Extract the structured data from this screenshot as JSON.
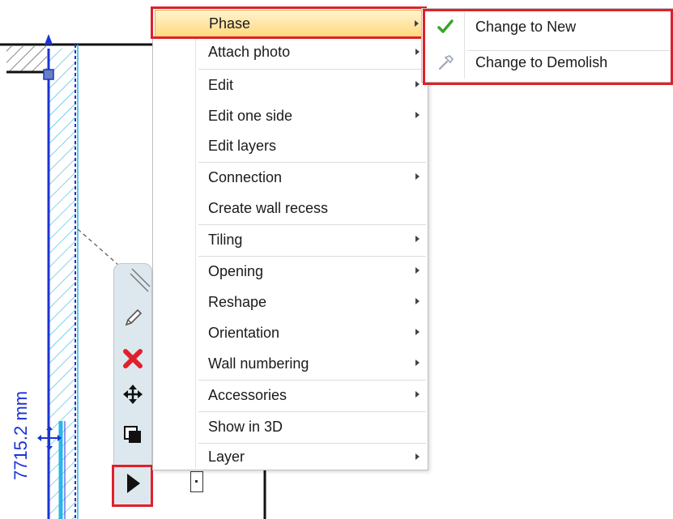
{
  "drawing": {
    "dimension_label": "7715.2 mm"
  },
  "toolbar": {
    "buttons": [
      {
        "name": "edit",
        "icon": "pencil-icon"
      },
      {
        "name": "delete",
        "icon": "red-x-icon"
      },
      {
        "name": "move",
        "icon": "move-arrows-icon"
      },
      {
        "name": "copy",
        "icon": "copy-icon"
      },
      {
        "name": "more",
        "icon": "play-triangle-icon"
      }
    ]
  },
  "context_menu": {
    "items": [
      {
        "label": "Phase",
        "submenu": true,
        "active": true
      },
      {
        "label": "Attach photo",
        "submenu": true
      },
      {
        "label": "Edit",
        "submenu": true
      },
      {
        "label": "Edit one side",
        "submenu": true
      },
      {
        "label": "Edit layers",
        "submenu": false
      },
      {
        "label": "Connection",
        "submenu": true
      },
      {
        "label": "Create wall recess",
        "submenu": false
      },
      {
        "label": "Tiling",
        "submenu": true
      },
      {
        "label": "Opening",
        "submenu": true
      },
      {
        "label": "Reshape",
        "submenu": true
      },
      {
        "label": "Orientation",
        "submenu": true
      },
      {
        "label": "Wall numbering",
        "submenu": true
      },
      {
        "label": "Accessories",
        "submenu": true
      },
      {
        "label": "Show in 3D",
        "submenu": false
      },
      {
        "label": "Layer",
        "submenu": true
      }
    ]
  },
  "phase_submenu": {
    "items": [
      {
        "label": "Change to New",
        "icon": "green-check-icon",
        "checked": true
      },
      {
        "label": "Change to Demolish",
        "icon": "hammer-icon",
        "checked": false
      }
    ]
  },
  "colors": {
    "accent_highlight": "#e0202a",
    "wall_blue": "#1a33d6",
    "wall_cyan": "#29b6e8",
    "menu_active_top": "#fff3cf",
    "menu_active_bottom": "#ffd87a"
  }
}
